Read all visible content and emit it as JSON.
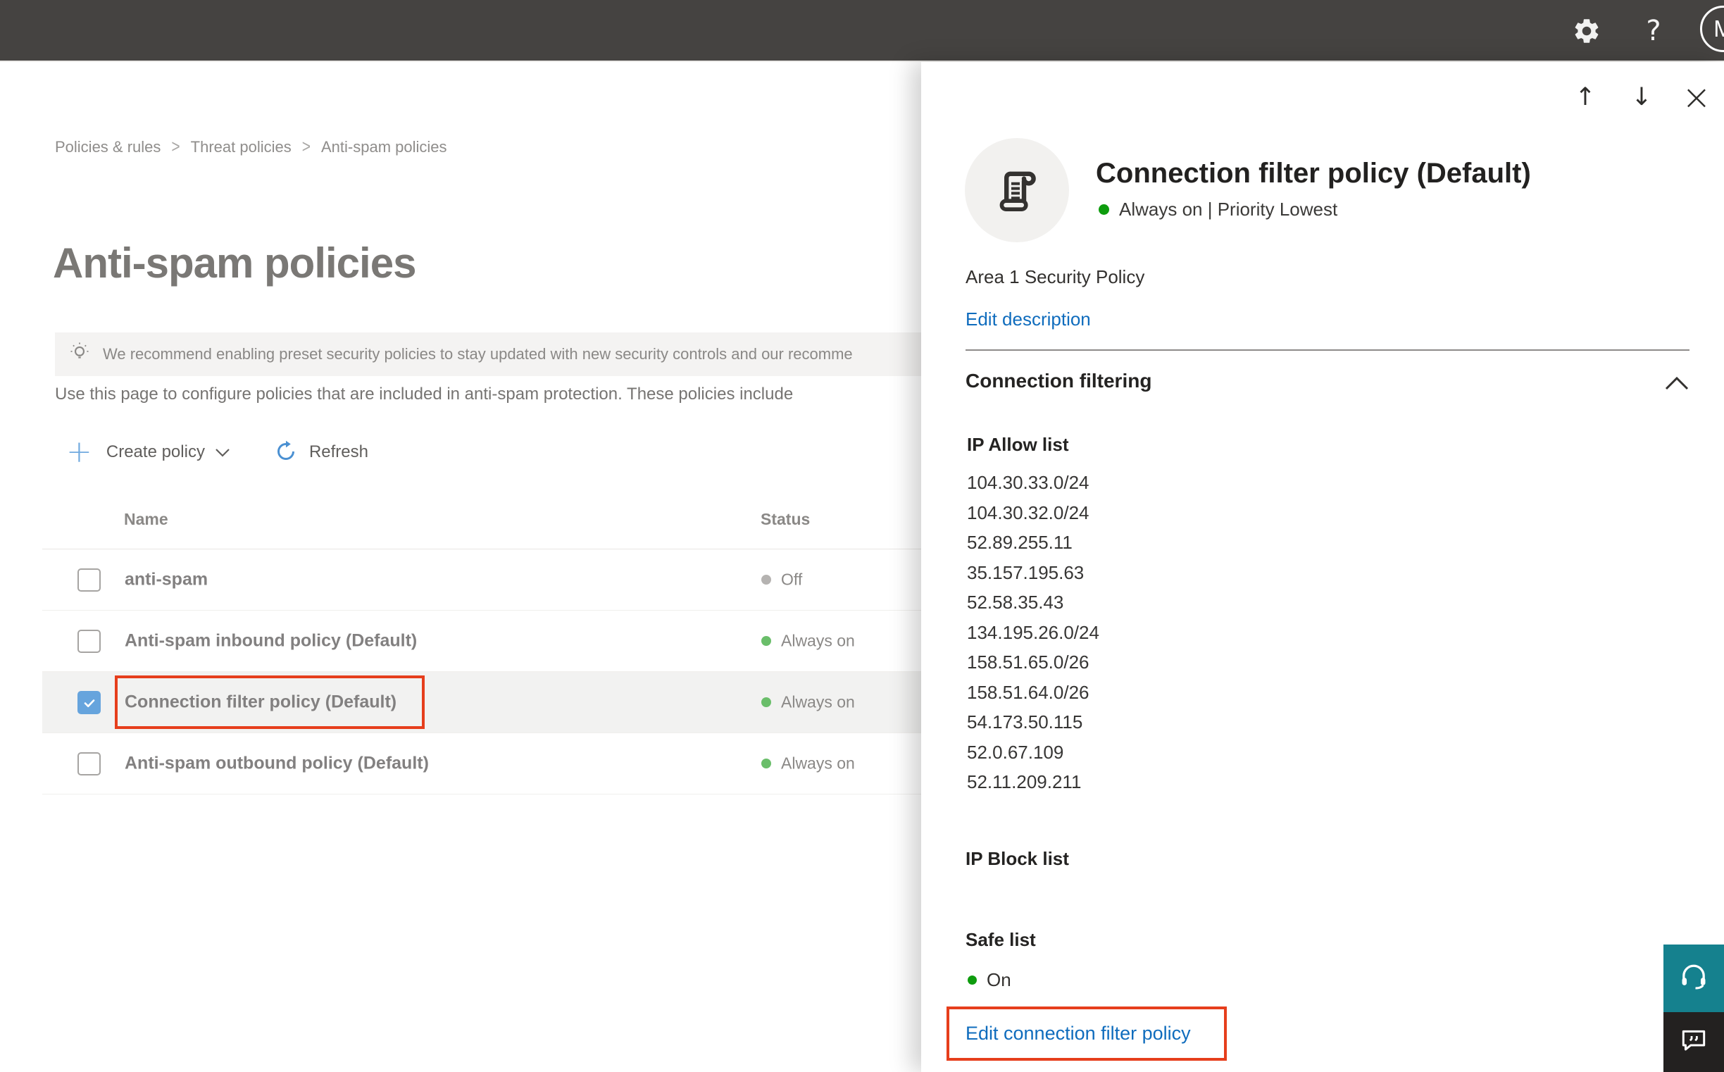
{
  "topbar": {
    "help_label": "?",
    "avatar_initial": "M"
  },
  "breadcrumb": {
    "separator": ">",
    "items": [
      "Policies & rules",
      "Threat policies",
      "Anti-spam policies"
    ]
  },
  "page": {
    "title": "Anti-spam policies",
    "banner": {
      "icon": "lightbulb-icon",
      "text": "We recommend enabling preset security policies to stay updated with new security controls and our recomme"
    },
    "description": "Use this page to configure policies that are included in anti-spam protection. These policies include",
    "toolbar": {
      "create_plus_glyph": "+",
      "create_label": "Create policy",
      "refresh_label": "Refresh"
    }
  },
  "table": {
    "columns": {
      "name": "Name",
      "status": "Status"
    },
    "rows": [
      {
        "name": "anti-spam",
        "status": "Off",
        "status_color": "#b5b3b1",
        "checked": false
      },
      {
        "name": "Anti-spam inbound policy (Default)",
        "status": "Always on",
        "status_color": "#6abe6a",
        "checked": false
      },
      {
        "name": "Connection filter policy (Default)",
        "status": "Always on",
        "status_color": "#6abe6a",
        "checked": true
      },
      {
        "name": "Anti-spam outbound policy (Default)",
        "status": "Always on",
        "status_color": "#6abe6a",
        "checked": false
      }
    ]
  },
  "panel": {
    "nav": {
      "up": "↑",
      "down": "↓",
      "close": "×"
    },
    "icon": "policy-scroll-icon",
    "title": "Connection filter policy (Default)",
    "status_line": "Always on | Priority Lowest",
    "description": "Area 1 Security Policy",
    "edit_description_label": "Edit description",
    "section_title": "Connection filtering",
    "ip_allow": {
      "title": "IP Allow list",
      "items": [
        "104.30.33.0/24",
        "104.30.32.0/24",
        "52.89.255.11",
        "35.157.195.63",
        "52.58.35.43",
        "134.195.26.0/24",
        "158.51.65.0/26",
        "158.51.64.0/26",
        "54.173.50.115",
        "52.0.67.109",
        "52.11.209.211"
      ]
    },
    "ip_block": {
      "title": "IP Block list"
    },
    "safe_list": {
      "title": "Safe list",
      "status": "On"
    },
    "edit_link": "Edit connection filter policy"
  },
  "widgets": {
    "support_icon": "headset-icon",
    "feedback_icon": "chat-bubble-icon"
  },
  "colors": {
    "topbar_bg": "#454341",
    "accent_link": "#0f6cbd",
    "panel_status_green": "#0e9c0e",
    "table_status_green": "#6abe6a",
    "table_status_off": "#b5b3b1",
    "annotation_red": "#e63e1c",
    "checkbox_checked": "#66a4dd",
    "support_teal": "#15818e",
    "feedback_dark": "#232120"
  }
}
